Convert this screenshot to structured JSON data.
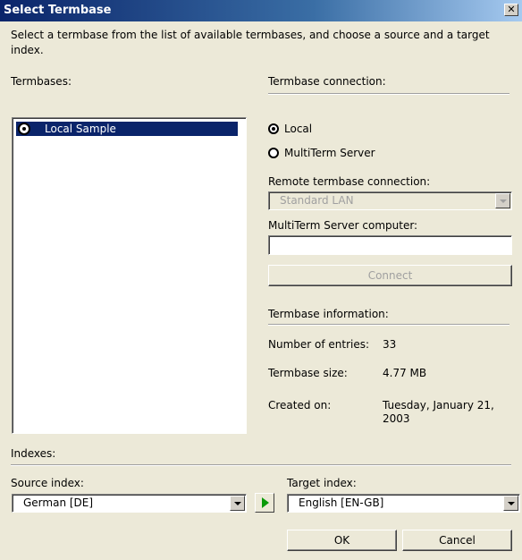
{
  "window": {
    "title": "Select Termbase",
    "close_glyph": "✕"
  },
  "intro": "Select a termbase from the list of available termbases, and choose a source and a target index.",
  "termbases": {
    "label": "Termbases:",
    "items": [
      {
        "label": "Local Sample",
        "selected": true
      }
    ]
  },
  "connection": {
    "label": "Termbase connection:",
    "local_label": "Local",
    "server_label": "MultiTerm Server",
    "remote_label": "Remote termbase connection:",
    "remote_value": "Standard LAN",
    "computer_label": "MultiTerm Server computer:",
    "computer_value": "",
    "connect_label": "Connect"
  },
  "info": {
    "label": "Termbase information:",
    "entries_label": "Number of entries:",
    "entries_value": "33",
    "size_label": "Termbase size:",
    "size_value": "4.77 MB",
    "created_label": "Created on:",
    "created_value_line1": "Tuesday, January 21,",
    "created_value_line2": "2003"
  },
  "indexes": {
    "label": "Indexes:",
    "source_label": "Source index:",
    "source_value": "German  [DE]",
    "target_label": "Target index:",
    "target_value": "English  [EN-GB]"
  },
  "buttons": {
    "ok": "OK",
    "cancel": "Cancel"
  },
  "icons": {
    "swap": "play-arrow-icon",
    "dropdown": "chevron-down-icon"
  },
  "colors": {
    "title_bar": "#0A246A",
    "selection": "#0A246A",
    "dialog_bg": "#ECE9D8",
    "play_arrow": "#0A9A0A"
  }
}
